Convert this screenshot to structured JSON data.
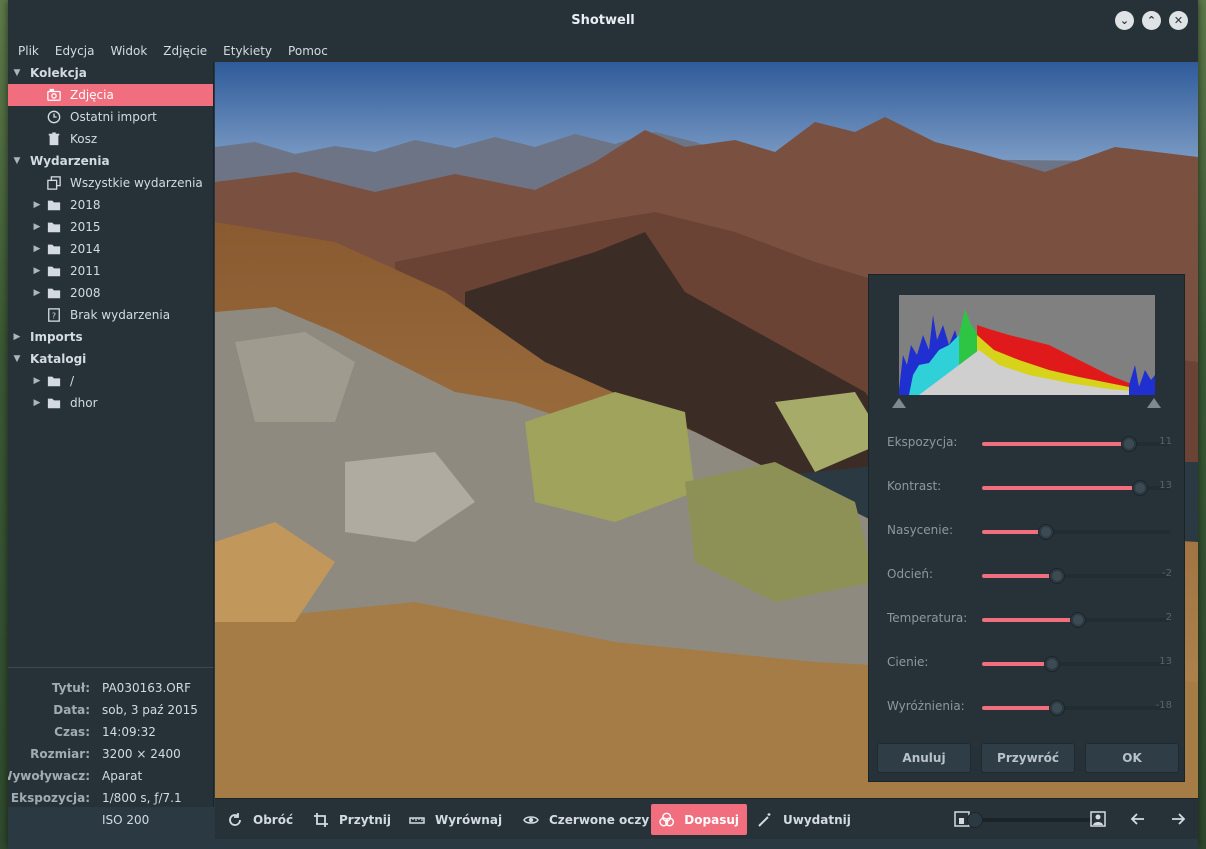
{
  "window": {
    "title": "Shotwell"
  },
  "menu": [
    "Plik",
    "Edycja",
    "Widok",
    "Zdjęcie",
    "Etykiety",
    "Pomoc"
  ],
  "sidebar": {
    "sections": {
      "kolekcja": "Kolekcja",
      "wydarzenia": "Wydarzenia",
      "imports": "Imports",
      "katalogi": "Katalogi"
    },
    "kolekcja_items": [
      "Zdjęcia",
      "Ostatni import",
      "Kosz"
    ],
    "wydarzenia_items": [
      "Wszystkie wydarzenia",
      "2018",
      "2015",
      "2014",
      "2011",
      "2008",
      "Brak wydarzenia"
    ],
    "katalogi_items": [
      "/",
      "dhor"
    ]
  },
  "info": {
    "rows": [
      {
        "key": "Tytuł:",
        "value": "PA030163.ORF"
      },
      {
        "key": "Data:",
        "value": "sob, 3 paź 2015"
      },
      {
        "key": "Czas:",
        "value": "14:09:32"
      },
      {
        "key": "Rozmiar:",
        "value": "3200 × 2400"
      },
      {
        "key": "Wywoływacz:",
        "value": "Aparat"
      },
      {
        "key": "Ekspozycja:",
        "value": "1/800 s, ƒ/7.1"
      },
      {
        "key": "",
        "value": "ISO 200"
      }
    ]
  },
  "adjust": {
    "sliders": [
      {
        "label": "Ekspozycja:",
        "value": "11",
        "fraction": 0.78
      },
      {
        "label": "Kontrast:",
        "value": "13",
        "fraction": 0.84
      },
      {
        "label": "Nasycenie:",
        "value": "",
        "fraction": 0.34
      },
      {
        "label": "Odcień:",
        "value": "-2",
        "fraction": 0.4
      },
      {
        "label": "Temperatura:",
        "value": "2",
        "fraction": 0.51
      },
      {
        "label": "Cienie:",
        "value": "13",
        "fraction": 0.37
      },
      {
        "label": "Wyróżnienia:",
        "value": "-18",
        "fraction": 0.4
      }
    ],
    "buttons": {
      "cancel": "Anuluj",
      "reset": "Przywróć",
      "ok": "OK"
    }
  },
  "toolbar": {
    "rotate": "Obróć",
    "crop": "Przytnij",
    "straighten": "Wyrównaj",
    "redeye": "Czerwone oczy",
    "adjust": "Dopasuj",
    "enhance": "Uwydatnij"
  },
  "colors": {
    "accent": "#f06e7d",
    "bg": "#263238",
    "panel": "#2b3a42"
  }
}
